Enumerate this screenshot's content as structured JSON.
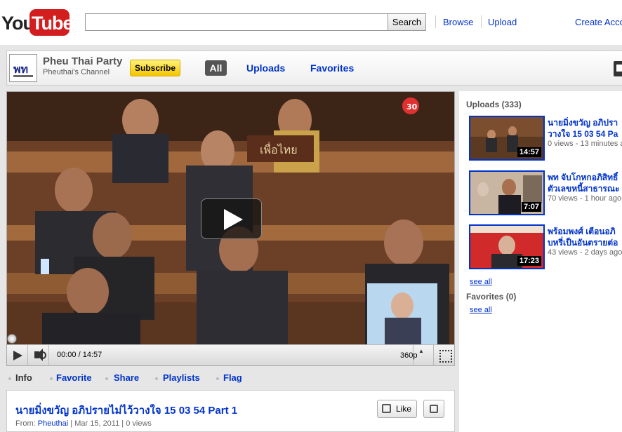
{
  "masthead": {
    "logo_you": "You",
    "logo_tube": "Tube",
    "search_placeholder": "",
    "search_button": "Search",
    "links": [
      "Browse",
      "Upload",
      "Create Acco"
    ]
  },
  "channel": {
    "name": "Pheu Thai Party",
    "subtitle": "Pheuthai's Channel",
    "subscribe_label": "Subscribe",
    "tabs": [
      "All",
      "Uploads",
      "Favorites"
    ],
    "active_tab": "All"
  },
  "player": {
    "time": "00:00 / 14:57",
    "quality": "360p",
    "overlay_badge": "30"
  },
  "actions": {
    "info": "Info",
    "favorite": "Favorite",
    "share": "Share",
    "playlists": "Playlists",
    "flag": "Flag"
  },
  "video": {
    "title": "นายมิ่งขวัญ อภิปรายไม่ไว้วางใจ 15 03 54 Part 1",
    "from_label": "From:",
    "user": "Pheuthai",
    "date": "Mar 15, 2011",
    "views": "0 views",
    "like_label": "Like"
  },
  "sidebar": {
    "uploads_heading": "Uploads (333)",
    "favorites_heading": "Favorites (0)",
    "see_all": "see all",
    "uploads": [
      {
        "title_line1": "นายมิ่งขวัญ อภิปรา",
        "title_line2": "วางใจ 15 03 54 Pa",
        "meta": "0 views - 13 minutes a",
        "duration": "14:57",
        "accent": "#6a4a2a"
      },
      {
        "title_line1": "พท จับโกหกอภิสิทธิ์",
        "title_line2": "ตัวเลขหนี้สาธารณะ",
        "meta": "70 views - 1 hour ago",
        "duration": "7:07",
        "accent": "#8a6a4a"
      },
      {
        "title_line1": "พร้อมพงศ์ เตือนอภิ",
        "title_line2": "บหรี่เป็นอันตรายต่อ",
        "meta": "43 views - 2 days ago",
        "duration": "17:23",
        "accent": "#cc2222"
      }
    ]
  }
}
